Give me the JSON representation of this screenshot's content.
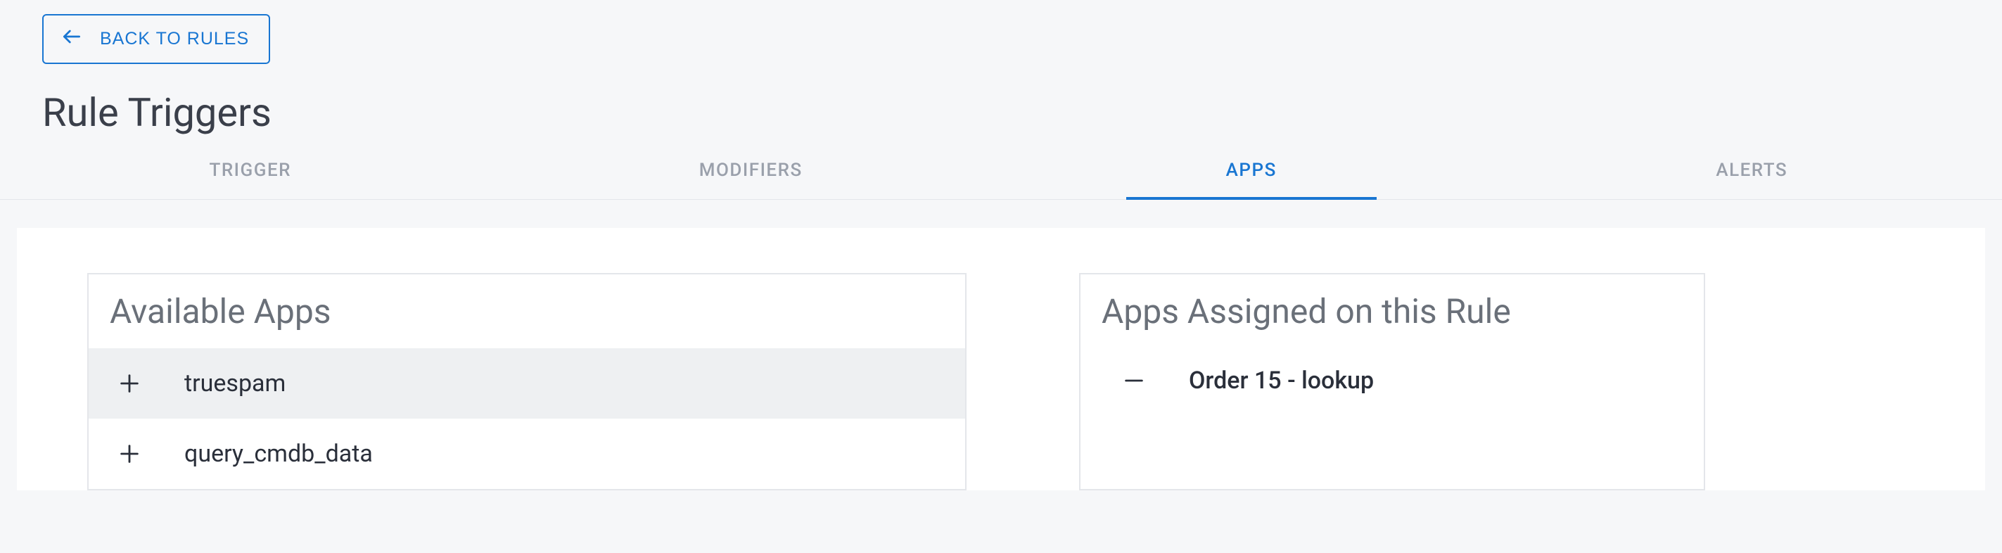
{
  "header": {
    "back_label": "BACK TO RULES",
    "title": "Rule Triggers"
  },
  "tabs": [
    {
      "label": "TRIGGER",
      "active": false
    },
    {
      "label": "MODIFIERS",
      "active": false
    },
    {
      "label": "APPS",
      "active": true
    },
    {
      "label": "ALERTS",
      "active": false
    }
  ],
  "available": {
    "title": "Available Apps",
    "items": [
      {
        "label": "truespam",
        "hovered": true
      },
      {
        "label": "query_cmdb_data",
        "hovered": false
      }
    ]
  },
  "assigned": {
    "title": "Apps Assigned on this Rule",
    "items": [
      {
        "label": "Order 15 - lookup"
      }
    ]
  }
}
